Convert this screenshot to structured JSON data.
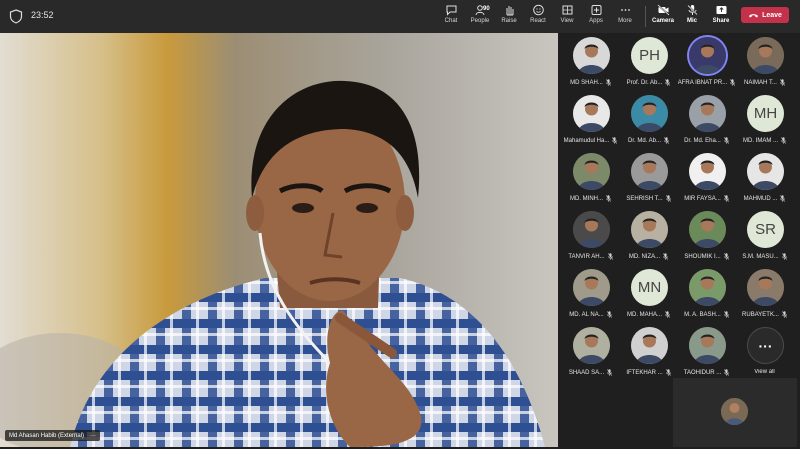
{
  "topbar": {
    "time": "23:52",
    "participant_count": "90",
    "tools": {
      "chat": "Chat",
      "people": "People",
      "raise": "Raise",
      "react": "React",
      "view": "View",
      "apps": "Apps",
      "more": "More",
      "camera": "Camera",
      "mic": "Mic",
      "share": "Share"
    },
    "leave": "Leave",
    "leave_color": "#c4314b"
  },
  "main_video": {
    "speaker_label": "Md Ahasan Habib (External)",
    "more_glyph": "···"
  },
  "participants": [
    {
      "name": "MD SHAH...",
      "kind": "photo",
      "tone": "#d8d8d8"
    },
    {
      "name": "Prof. Dr. Ab...",
      "kind": "initials",
      "initials": "PH"
    },
    {
      "name": "AFRA IBNAT PR...",
      "kind": "photo",
      "tone": "#3a3a6a",
      "ring": true
    },
    {
      "name": "NAIMAH T...",
      "kind": "photo",
      "tone": "#7a6a5a"
    },
    {
      "name": "Mahamudul Ha...",
      "kind": "photo",
      "tone": "#e8e8e8"
    },
    {
      "name": "Dr. Md. Ab...",
      "kind": "photo",
      "tone": "#3b8aa6"
    },
    {
      "name": "Dr. Md. Eha...",
      "kind": "photo",
      "tone": "#9aa0a8"
    },
    {
      "name": "MD. IMAM ...",
      "kind": "initials",
      "initials": "MH"
    },
    {
      "name": "MD. MINH...",
      "kind": "photo",
      "tone": "#7d8a6a"
    },
    {
      "name": "SEHRISH T...",
      "kind": "photo",
      "tone": "#9a9a9a"
    },
    {
      "name": "MIR FAYSA...",
      "kind": "photo",
      "tone": "#f0f0f0"
    },
    {
      "name": "MAHMUD ...",
      "kind": "photo",
      "tone": "#e6e6e6"
    },
    {
      "name": "TANVIR AH...",
      "kind": "photo",
      "tone": "#4a4a4a"
    },
    {
      "name": "MD. NIZA...",
      "kind": "photo",
      "tone": "#b8b0a0"
    },
    {
      "name": "SHOUMIK I...",
      "kind": "photo",
      "tone": "#6a8a5a"
    },
    {
      "name": "S.M. MASU...",
      "kind": "initials",
      "initials": "SR"
    },
    {
      "name": "MD. AL NA...",
      "kind": "photo",
      "tone": "#a09a8a"
    },
    {
      "name": "MD. MAHA...",
      "kind": "initials",
      "initials": "MN"
    },
    {
      "name": "M. A. BASH...",
      "kind": "photo",
      "tone": "#7a9a6a"
    },
    {
      "name": "RUBAYETK...",
      "kind": "photo",
      "tone": "#8a7a6a"
    },
    {
      "name": "SHAAD SA...",
      "kind": "photo",
      "tone": "#b0b0a0"
    },
    {
      "name": "IFTEKHAR ...",
      "kind": "photo",
      "tone": "#d0d0d0"
    },
    {
      "name": "TAOHIDUR ...",
      "kind": "photo",
      "tone": "#8a9a8a"
    }
  ],
  "view_all": {
    "label": "View all",
    "glyph": "···"
  }
}
